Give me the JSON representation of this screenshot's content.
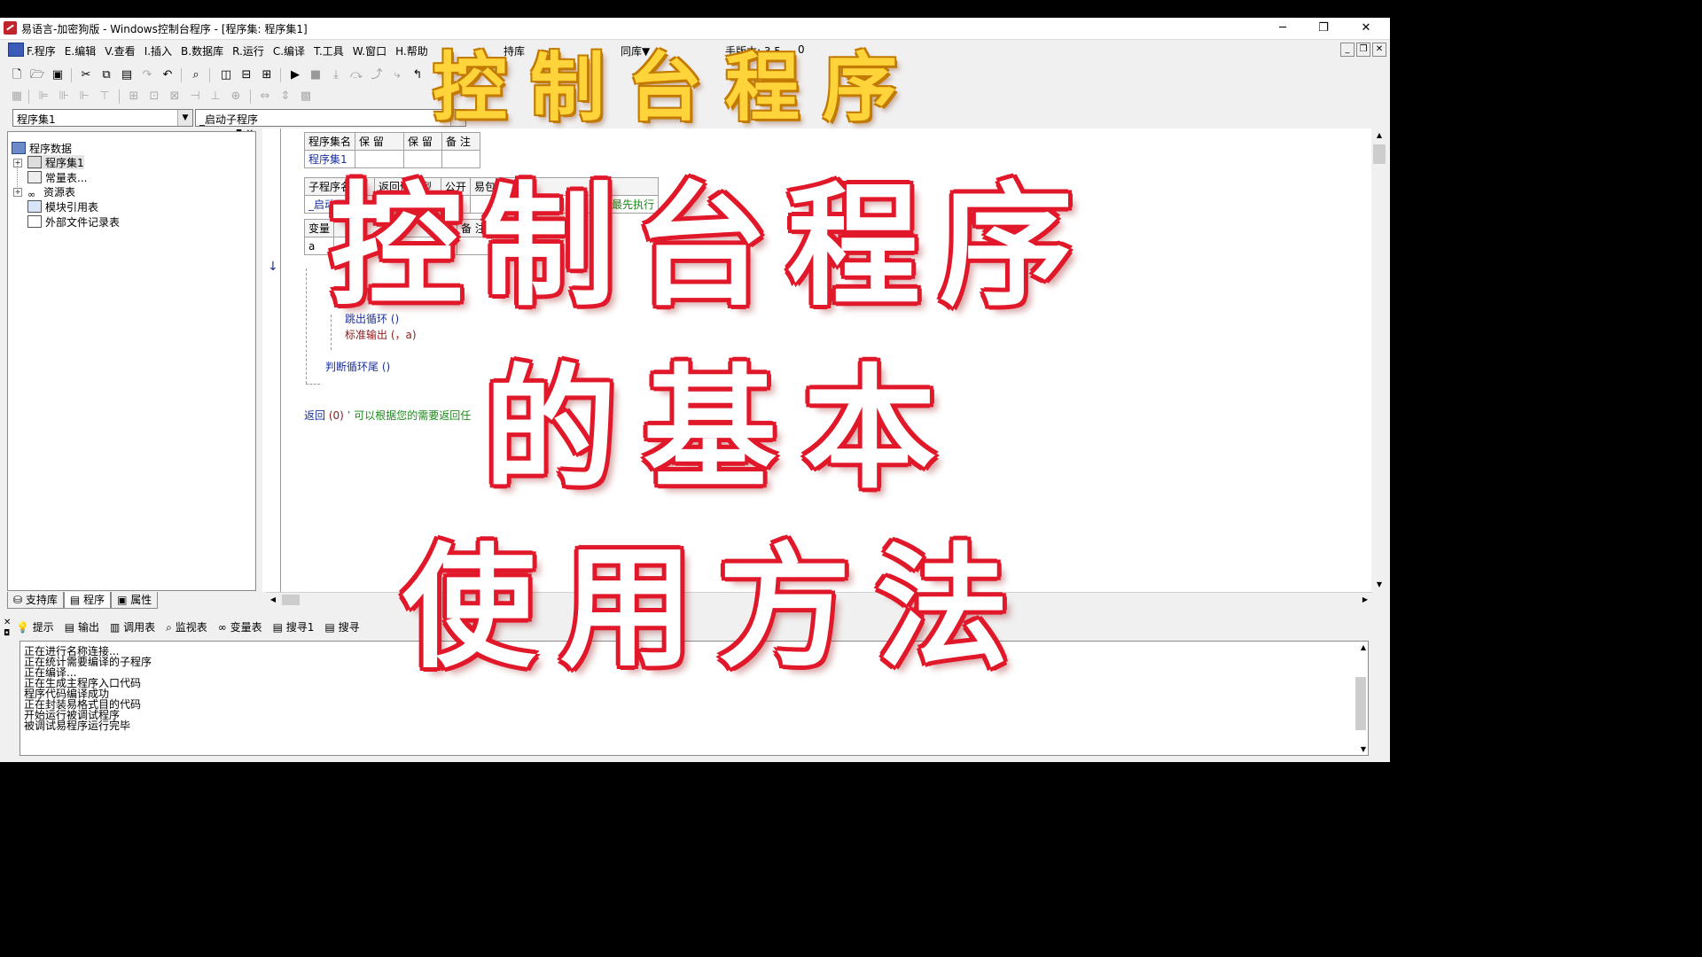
{
  "window": {
    "title": "易语言-加密狗版 - Windows控制台程序 - [程序集: 程序集1]",
    "controls": [
      "─",
      "❐",
      "✕"
    ]
  },
  "menu": {
    "items": [
      "F.程序",
      "E.编辑",
      "V.查看",
      "I.插入",
      "B.数据库",
      "R.运行",
      "C.编译",
      "T.工具",
      "W.窗口",
      "H.帮助"
    ],
    "extra_1": "持库",
    "extra_2": "同库▼",
    "version_label": "手版本: 3.5",
    "version_partial": "0",
    "mdi_controls": [
      "_",
      "❐",
      "✕"
    ]
  },
  "combos": {
    "assembly": "程序集1",
    "subprogram": "_启动子程序"
  },
  "tree": {
    "root": "程序数据",
    "items": [
      "程序集1",
      "常量表...",
      "资源表",
      "模块引用表",
      "外部文件记录表"
    ]
  },
  "left_tabs": [
    "支持库",
    "程序",
    "属性"
  ],
  "assembly_table": {
    "headers": [
      "程序集名",
      "保 留",
      "保 留",
      "备 注"
    ],
    "row": [
      "程序集1",
      "",
      "",
      ""
    ]
  },
  "sub_table": {
    "headers": [
      "子程序名",
      "返回值类型",
      "公开",
      "易包",
      "备 注"
    ],
    "row_name": "_启动子",
    "row_note": "后最先执行"
  },
  "var_table": {
    "header_first": "变量",
    "header_note": "备 注",
    "row_first": "a"
  },
  "code": {
    "loop_continue": "跳出循环 ()",
    "std_output": "标准输出 (，a)",
    "loop_tail": "判断循环尾 ()",
    "return_kw": "返回",
    "return_args": "(0)",
    "comment": "’ 可以根据您的需要返回任"
  },
  "output_tabs": [
    "提示",
    "输出",
    "调用表",
    "监视表",
    "变量表",
    "搜寻1",
    "搜寻"
  ],
  "output_lines": [
    "正在进行名称连接...",
    "正在统计需要编译的子程序",
    "正在编译...",
    "正在生成主程序入口代码",
    "程序代码编译成功",
    "正在封装易格式目的代码",
    "开始运行被调试程序",
    "被调试易程序运行完毕"
  ],
  "overlay": {
    "small_title": "控制台程序",
    "line1": "控制台程序",
    "line2": "的基本",
    "line3": "使用方法"
  },
  "colors": {
    "overlay_red": "#e0182a",
    "overlay_yellow": "#ffd43a",
    "code_blue": "#1b2f9c",
    "comment_green": "#1a8a1a"
  }
}
